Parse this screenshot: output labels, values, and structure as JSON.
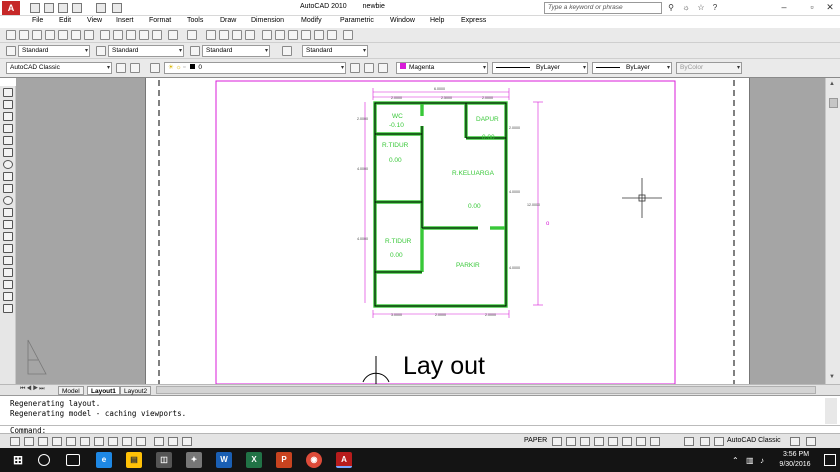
{
  "window": {
    "app_title": "AutoCAD 2010",
    "doc_title": "newbie",
    "search_placeholder": "Type a keyword or phrase"
  },
  "menu": [
    "File",
    "Edit",
    "View",
    "Insert",
    "Format",
    "Tools",
    "Draw",
    "Dimension",
    "Modify",
    "Parametric",
    "Window",
    "Help",
    "Express"
  ],
  "toolbar_styles": {
    "text_style": "Standard",
    "dim_style": "Standard",
    "table_style": "Standard",
    "mleader_style": "Standard"
  },
  "toolbar_layers": {
    "workspace": "AutoCAD Classic",
    "layer": "0",
    "color": "Magenta",
    "linetype": "ByLayer",
    "lineweight": "ByLayer",
    "plotstyle": "ByColor",
    "color_hex": "#d81bd8"
  },
  "drawing": {
    "rooms": [
      {
        "name": "WC",
        "value": "-0.10"
      },
      {
        "name": "DAPUR",
        "value": "0.00"
      },
      {
        "name": "R.TIDUR",
        "value": "0.00"
      },
      {
        "name": "R.KELUARGA",
        "value": "0.00"
      },
      {
        "name": "R.TIDUR",
        "value": "0.00"
      },
      {
        "name": "PARKIR",
        "value": ""
      }
    ],
    "dims": {
      "top_total": "6.0000",
      "top_a": "2.0000",
      "top_b": "2.5000",
      "top_c": "2.0000",
      "right_total": "12.0000",
      "right_a": "2.0000",
      "right_b": "4.0000",
      "right_c": "4.0000",
      "left_a": "2.0000",
      "left_b": "4.0000",
      "left_c": "4.0000",
      "bottom_a": "3.0000",
      "bottom_b": "2.0000",
      "bottom_c": "2.0000"
    },
    "stray_mark": "o",
    "layout_label": "Lay out",
    "wall_color": "#38c838",
    "dim_color": "#d81bd8"
  },
  "tabs": {
    "model": "Model",
    "layout1": "Layout1",
    "layout2": "Layout2"
  },
  "command": {
    "line1": "Regenerating layout.",
    "line2": "Regenerating model - caching viewports.",
    "prompt": "Command:"
  },
  "status": {
    "space": "PAPER",
    "workspace": "AutoCAD Classic"
  },
  "taskbar": {
    "time": "3:56 PM",
    "date": "9/30/2016"
  }
}
